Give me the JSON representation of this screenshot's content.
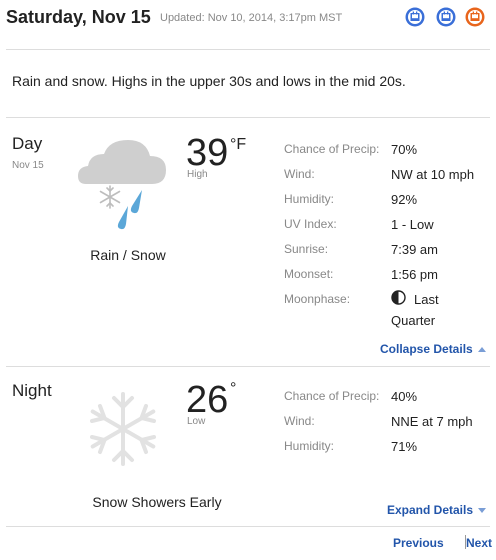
{
  "header": {
    "title": "Saturday, Nov 15",
    "updated": "Updated: Nov 10, 2014, 3:17pm MST",
    "share_icons": [
      "blue-badge-icon",
      "blue-badge-icon",
      "orange-badge-icon"
    ],
    "colors": {
      "blue": "#3a6fd8",
      "orange": "#e8651c"
    }
  },
  "summary": "Rain and snow. Highs in the upper 30s and lows in the mid 20s.",
  "day": {
    "name": "Day",
    "date": "Nov 15",
    "condition": "Rain / Snow",
    "icon": "rain-snow-cloud-icon",
    "temp": "39",
    "unit": "°F",
    "temp_label": "High",
    "details": [
      {
        "label": "Chance of Precip:",
        "value": "70%"
      },
      {
        "label": "Wind:",
        "value": "NW at 10 mph"
      },
      {
        "label": "Humidity:",
        "value": "92%"
      },
      {
        "label": "UV Index:",
        "value": "1 - Low"
      },
      {
        "label": "Sunrise:",
        "value": "7:39 am"
      },
      {
        "label": "Moonset:",
        "value": "1:56 pm"
      },
      {
        "label": "Moonphase:",
        "value": "Last",
        "value2": "Quarter",
        "icon": "half-moon-icon"
      }
    ],
    "toggle": "Collapse Details"
  },
  "night": {
    "name": "Night",
    "condition": "Snow Showers Early",
    "icon": "snowflake-icon",
    "temp": "26",
    "unit": "°",
    "temp_label": "Low",
    "details": [
      {
        "label": "Chance of Precip:",
        "value": "40%"
      },
      {
        "label": "Wind:",
        "value": "NNE at 7 mph"
      },
      {
        "label": "Humidity:",
        "value": "71%"
      }
    ],
    "toggle": "Expand Details"
  },
  "pager": {
    "previous": "Previous",
    "next": "Next"
  }
}
